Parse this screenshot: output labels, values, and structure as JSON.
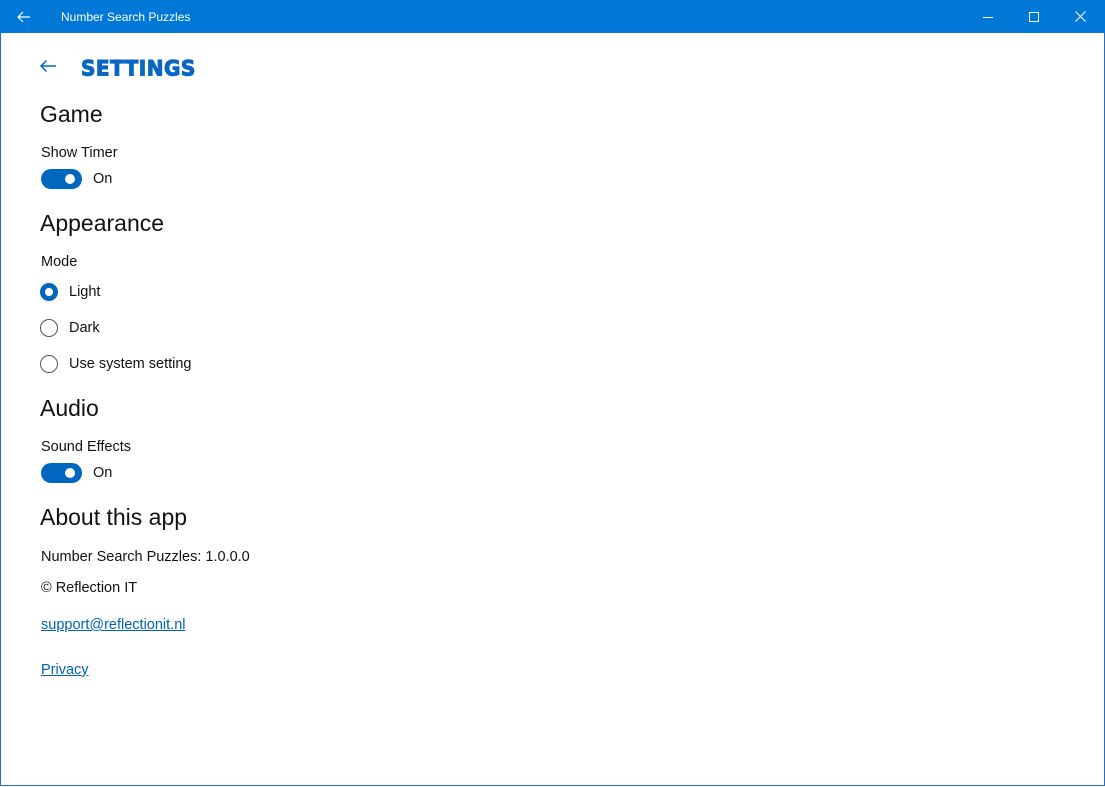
{
  "titlebar": {
    "app_title": "Number Search Puzzles",
    "back_icon": "arrow-left-icon",
    "minimize_icon": "minimize-icon",
    "maximize_icon": "maximize-icon",
    "close_icon": "close-icon",
    "background": "#0078d7"
  },
  "page": {
    "title": "Settings",
    "back_icon": "arrow-left-icon",
    "accent": "#0067c0"
  },
  "game": {
    "heading": "Game",
    "show_timer_label": "Show Timer",
    "show_timer_state": "On",
    "show_timer_on": true
  },
  "appearance": {
    "heading": "Appearance",
    "mode_label": "Mode",
    "options": [
      {
        "label": "Light",
        "selected": true
      },
      {
        "label": "Dark",
        "selected": false
      },
      {
        "label": "Use system setting",
        "selected": false
      }
    ]
  },
  "audio": {
    "heading": "Audio",
    "sound_effects_label": "Sound Effects",
    "sound_effects_state": "On",
    "sound_effects_on": true
  },
  "about": {
    "heading": "About this app",
    "version_text": "Number Search Puzzles: 1.0.0.0",
    "copyright_text": "© Reflection IT",
    "support_link": "support@reflectionit.nl",
    "privacy_link": "Privacy"
  }
}
